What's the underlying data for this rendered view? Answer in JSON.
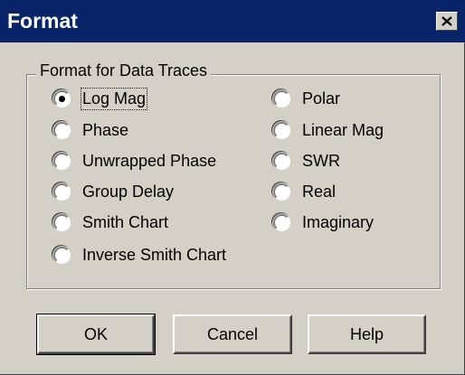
{
  "dialog": {
    "title": "Format",
    "close_icon": "close-x-icon"
  },
  "group": {
    "legend": "Format for Data Traces",
    "selected": "Log Mag",
    "left_options": [
      "Log Mag",
      "Phase",
      "Unwrapped Phase",
      "Group Delay",
      "Smith Chart",
      "Inverse Smith Chart"
    ],
    "right_options": [
      "Polar",
      "Linear Mag",
      "SWR",
      "Real",
      "Imaginary"
    ]
  },
  "buttons": {
    "ok": "OK",
    "cancel": "Cancel",
    "help": "Help"
  }
}
